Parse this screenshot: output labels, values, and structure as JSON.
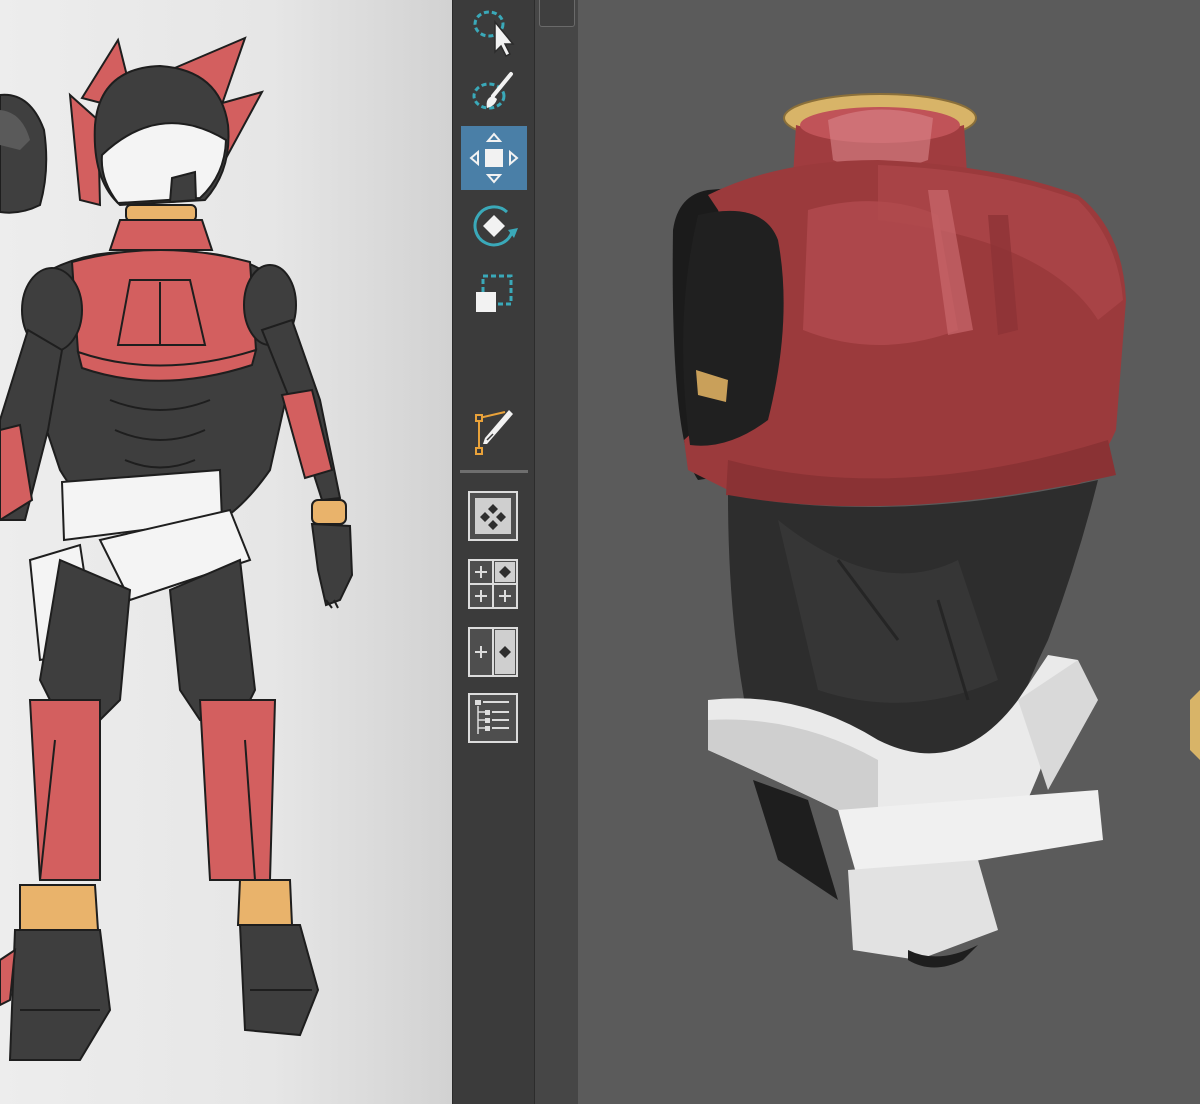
{
  "app": {
    "panels": [
      "reference-image",
      "tool-bar",
      "3d-viewport"
    ]
  },
  "toolbar": {
    "tools": [
      {
        "name": "select-lasso-tool",
        "icon": "select-lasso-arrow-icon",
        "active": false
      },
      {
        "name": "paint-select-tool",
        "icon": "brush-lasso-icon",
        "active": false
      },
      {
        "name": "move-tool",
        "icon": "move-arrows-icon",
        "active": true
      },
      {
        "name": "rotate-tool",
        "icon": "rotate-diamond-icon",
        "active": false
      },
      {
        "name": "scale-tool",
        "icon": "scale-box-icon",
        "active": false
      },
      {
        "name": "knife-tool",
        "icon": "knife-path-icon",
        "active": false
      }
    ],
    "view_buttons": [
      {
        "name": "single-view",
        "icon": "single-view-icon"
      },
      {
        "name": "quad-view",
        "icon": "quad-view-icon"
      },
      {
        "name": "split-view",
        "icon": "split-view-icon"
      },
      {
        "name": "outliner",
        "icon": "outliner-icon"
      }
    ]
  },
  "colors": {
    "accent": "#4a7fa7",
    "icon_teal": "#3aa9b9",
    "armor_red": "#d35f5f",
    "suit_dark": "#3e3e3e",
    "belt_white": "#f4f4f4",
    "gold": "#e9b36b",
    "viewport_bg": "#5b5b5b",
    "model_red": "#9b3a3c"
  }
}
